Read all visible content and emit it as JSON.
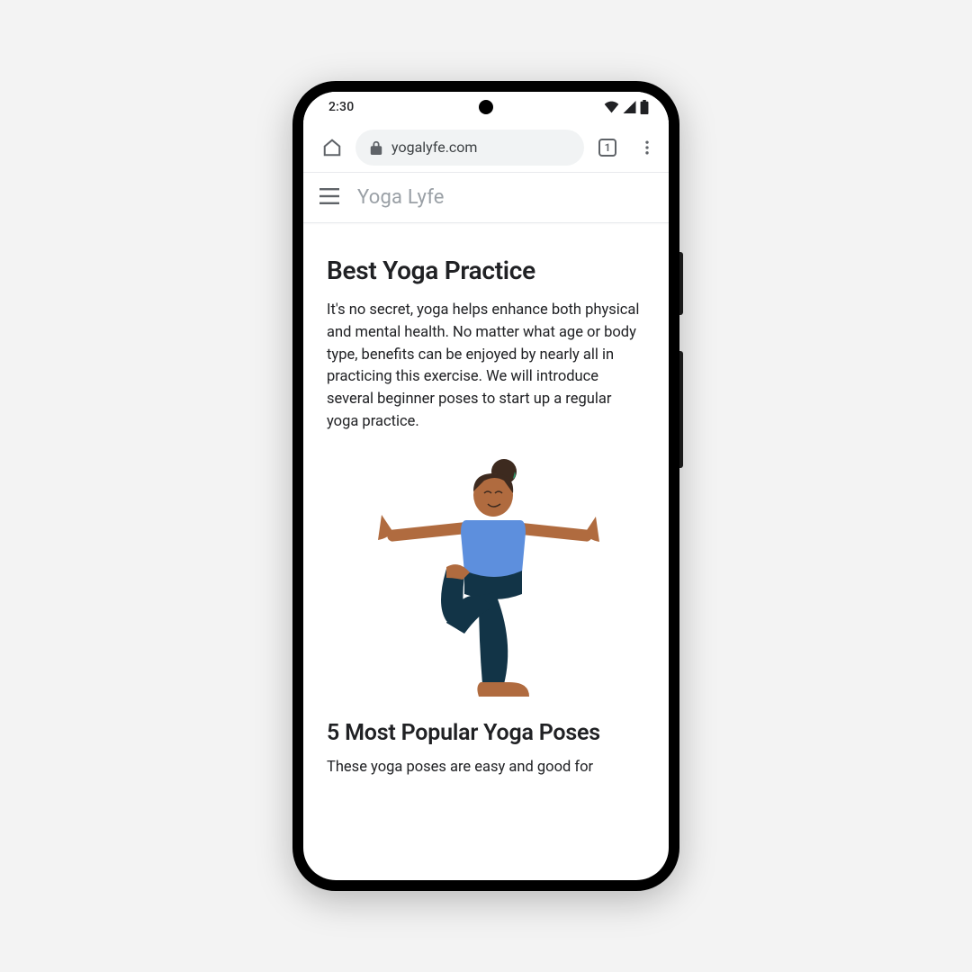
{
  "status": {
    "time": "2:30"
  },
  "browser": {
    "url": "yogalyfe.com",
    "tab_count": "1"
  },
  "site": {
    "brand": "Yoga Lyfe"
  },
  "article": {
    "title": "Best Yoga Practice",
    "intro": "It's no secret, yoga helps enhance both physical and mental health. No matter what age or body type, benefits can be enjoyed by nearly all in practicing this exercise. We will introduce several beginner poses  to start up a regular yoga practice.",
    "subtitle": "5 Most Popular Yoga Poses",
    "sub_intro": "These yoga poses are easy and good for"
  }
}
